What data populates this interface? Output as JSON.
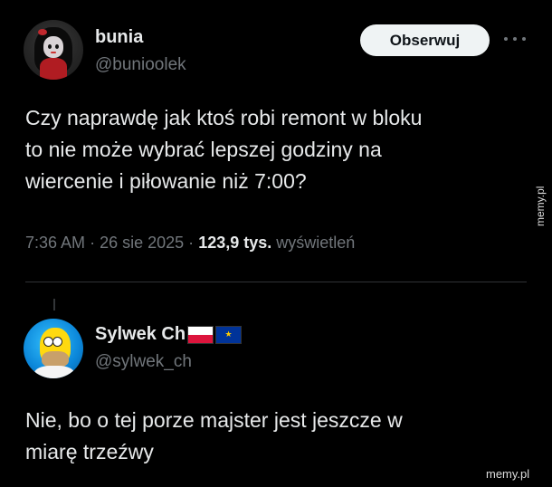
{
  "post": {
    "author_name": "bunia",
    "author_handle": "@bunioolek",
    "follow_label": "Obserwuj",
    "text": "Czy naprawdę jak ktoś robi remont w bloku\nto nie może wybrać lepszej godziny na\nwiercenie i piłowanie niż 7:00?",
    "time": "7:36 AM",
    "separator": "·",
    "date": "26 sie 2025",
    "views_count": "123,9 tys.",
    "views_label": "wyświetleń"
  },
  "reply": {
    "author_name": "Sylwek Ch",
    "author_handle": "@sylwek_ch",
    "text": "Nie, bo o tej porze majster jest jeszcze w\nmiarę trzeźwy"
  },
  "watermarks": {
    "side": "memy.pl",
    "bottom": "memy.pl"
  },
  "icons": {
    "more": "more-horizontal-icon",
    "flag_pl": "poland-flag-icon",
    "flag_eu": "eu-flag-icon"
  },
  "colors": {
    "background": "#000000",
    "text": "#e7e9ea",
    "muted": "#71767b",
    "button_bg": "#eff3f4",
    "divider": "#2f3336"
  }
}
